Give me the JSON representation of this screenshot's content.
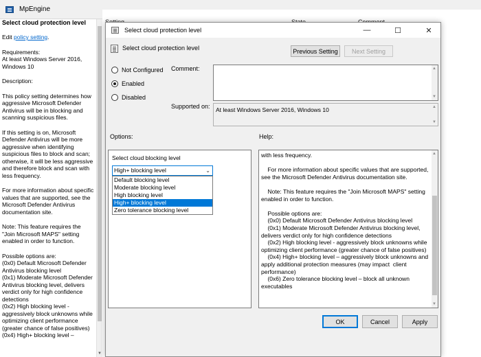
{
  "bg_window": {
    "title": "MpEngine",
    "columns": [
      "Setting",
      "State",
      "Comment"
    ]
  },
  "left_pane": {
    "heading": "Select cloud protection level",
    "edit_prefix": "Edit ",
    "edit_link": "policy setting",
    "edit_suffix": ".",
    "paragraphs": [
      "Requirements:\nAt least Windows Server 2016, Windows 10",
      "Description:",
      "    This policy setting determines how aggressive Microsoft Defender Antivirus will be in blocking and scanning suspicious files.",
      "    If this setting is on, Microsoft Defender Antivirus will be more aggressive when identifying suspicious files to block and scan; otherwise, it will be less aggressive and therefore block and scan with less frequency.",
      "    For more information about specific values that are supported, see the Microsoft Defender Antivirus documentation site.",
      "    Note: This feature requires the \"Join Microsoft MAPS\" setting enabled in order to function.",
      "    Possible options are:\n    (0x0) Default Microsoft Defender Antivirus blocking level\n    (0x1) Moderate Microsoft Defender Antivirus blocking level, delivers verdict only for high confidence detections\n    (0x2) High blocking level - aggressively block unknowns while optimizing client performance (greater chance of false positives)\n    (0x4) High+ blocking level –"
    ]
  },
  "dialog": {
    "title": "Select cloud protection level",
    "policy_title": "Select cloud protection level",
    "prev_button": "Previous Setting",
    "next_button": "Next Setting",
    "radios": [
      {
        "label": "Not Configured",
        "checked": false
      },
      {
        "label": "Enabled",
        "checked": true
      },
      {
        "label": "Disabled",
        "checked": false
      }
    ],
    "comment_label": "Comment:",
    "supported_label": "Supported on:",
    "supported_value": "At least Windows Server 2016, Windows 10",
    "options_label": "Options:",
    "help_label": "Help:",
    "options": {
      "caption": "Select cloud blocking level",
      "selected": "High+ blocking level",
      "items": [
        {
          "label": "Default blocking level",
          "highlighted": false
        },
        {
          "label": "Moderate blocking level",
          "highlighted": false
        },
        {
          "label": "High blocking level",
          "highlighted": false
        },
        {
          "label": "High+ blocking level",
          "highlighted": true
        },
        {
          "label": "Zero tolerance blocking level",
          "highlighted": false
        }
      ]
    },
    "help_lines": [
      "with less frequency.",
      "",
      "    For more information about specific values that are supported, see the Microsoft Defender Antivirus documentation site.",
      "",
      "    Note: This feature requires the \"Join Microsoft MAPS\" setting enabled in order to function.",
      "",
      "    Possible options are:",
      "    (0x0) Default Microsoft Defender Antivirus blocking level",
      "    (0x1) Moderate Microsoft Defender Antivirus blocking level, delivers verdict only for high confidence detections",
      "    (0x2) High blocking level - aggressively block unknowns while optimizing client performance (greater chance of false positives)",
      "    (0x4) High+ blocking level – aggressively block unknowns and apply additional protection measures (may impact  client performance)",
      "    (0x6) Zero tolerance blocking level – block all unknown executables"
    ],
    "ok_button": "OK",
    "cancel_button": "Cancel",
    "apply_button": "Apply"
  },
  "colors": {
    "accent": "#0078d7",
    "link": "#0066cc",
    "dialog_bg": "#f0f0f0"
  },
  "icons": [
    "app-icon",
    "policy-icon",
    "minimize-icon",
    "maximize-icon",
    "close-icon",
    "chevron-down-icon"
  ]
}
